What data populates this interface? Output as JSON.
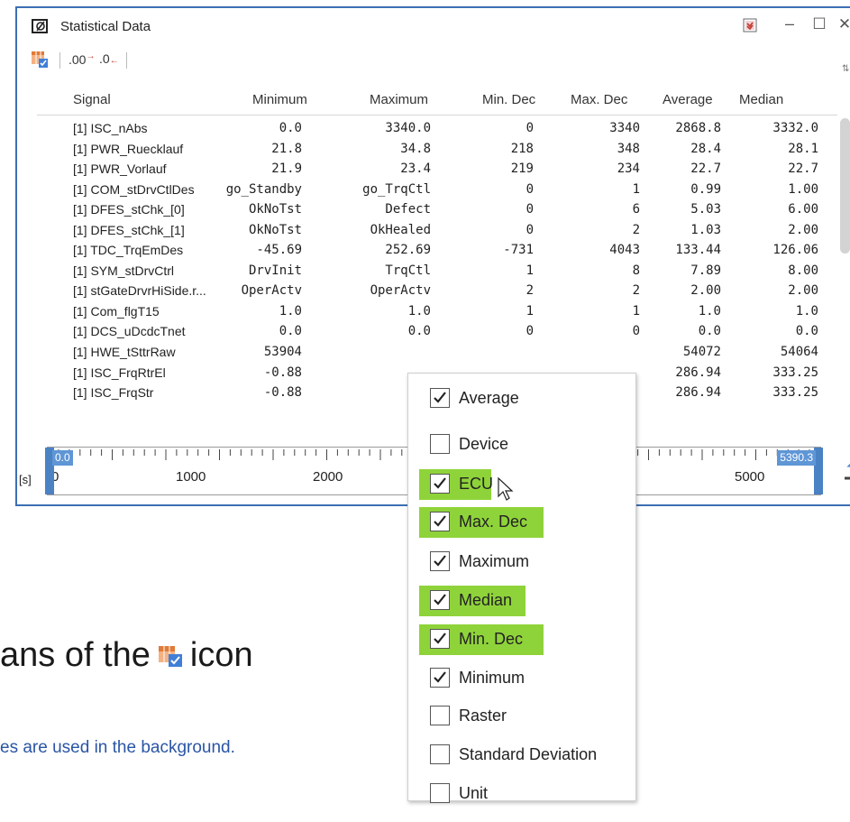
{
  "background": {
    "heading_fragment": "ans of the",
    "heading_suffix": "icon",
    "note_fragment": "es are used in the background."
  },
  "window": {
    "title": "Statistical Data",
    "icon": "diameter-icon",
    "buttons": {
      "minimize": "–",
      "maximize": "☐",
      "close": "✕"
    }
  },
  "toolbar": {
    "column_chooser_icon": "column-chooser-icon",
    "increase_decimals": ".00",
    "decrease_decimals": ".0"
  },
  "columns": [
    "Signal",
    "Minimum",
    "Maximum",
    "Min. Dec",
    "Max. Dec",
    "Average",
    "Median"
  ],
  "rows": [
    {
      "signal": "[1] ISC_nAbs",
      "min": "0.0",
      "max": "3340.0",
      "min_dec": "0",
      "max_dec": "3340",
      "avg": "2868.8",
      "median": "3332.0"
    },
    {
      "signal": "[1] PWR_Ruecklauf",
      "min": "21.8",
      "max": "34.8",
      "min_dec": "218",
      "max_dec": "348",
      "avg": "28.4",
      "median": "28.1"
    },
    {
      "signal": "[1] PWR_Vorlauf",
      "min": "21.9",
      "max": "23.4",
      "min_dec": "219",
      "max_dec": "234",
      "avg": "22.7",
      "median": "22.7"
    },
    {
      "signal": "[1] COM_stDrvCtlDes",
      "min": "go_Standby",
      "max": "go_TrqCtl",
      "min_dec": "0",
      "max_dec": "1",
      "avg": "0.99",
      "median": "1.00"
    },
    {
      "signal": "[1] DFES_stChk_[0]",
      "min": "OkNoTst",
      "max": "Defect",
      "min_dec": "0",
      "max_dec": "6",
      "avg": "5.03",
      "median": "6.00"
    },
    {
      "signal": "[1] DFES_stChk_[1]",
      "min": "OkNoTst",
      "max": "OkHealed",
      "min_dec": "0",
      "max_dec": "2",
      "avg": "1.03",
      "median": "2.00"
    },
    {
      "signal": "[1] TDC_TrqEmDes",
      "min": "-45.69",
      "max": "252.69",
      "min_dec": "-731",
      "max_dec": "4043",
      "avg": "133.44",
      "median": "126.06"
    },
    {
      "signal": "[1] SYM_stDrvCtrl",
      "min": "DrvInit",
      "max": "TrqCtl",
      "min_dec": "1",
      "max_dec": "8",
      "avg": "7.89",
      "median": "8.00"
    },
    {
      "signal": "[1] stGateDrvrHiSide.r...",
      "min": "OperActv",
      "max": "OperActv",
      "min_dec": "2",
      "max_dec": "2",
      "avg": "2.00",
      "median": "2.00"
    },
    {
      "signal": "[1] Com_flgT15",
      "min": "1.0",
      "max": "1.0",
      "min_dec": "1",
      "max_dec": "1",
      "avg": "1.0",
      "median": "1.0"
    },
    {
      "signal": "[1] DCS_uDcdcTnet",
      "min": "0.0",
      "max": "0.0",
      "min_dec": "0",
      "max_dec": "0",
      "avg": "0.0",
      "median": "0.0"
    },
    {
      "signal": "[1] HWE_tSttrRaw",
      "min": "53904",
      "max": "",
      "min_dec": "",
      "max_dec": "",
      "avg": "54072",
      "median": "54064"
    },
    {
      "signal": "[1] ISC_FrqRtrEl",
      "min": "-0.88",
      "max": "",
      "min_dec": "",
      "max_dec": "",
      "avg": "286.94",
      "median": "333.25"
    },
    {
      "signal": "[1] ISC_FrqStr",
      "min": "-0.88",
      "max": "",
      "min_dec": "",
      "max_dec": "",
      "avg": "286.94",
      "median": "333.25"
    }
  ],
  "timeline": {
    "unit": "[s]",
    "start_value": "0.0",
    "end_value": "5390.3",
    "zero_label": "0",
    "tick_labels": [
      "1000",
      "2000",
      "5000"
    ]
  },
  "column_menu": {
    "items": [
      {
        "label": "Average",
        "checked": true,
        "highlighted": false
      },
      {
        "label": "Device",
        "checked": false,
        "highlighted": false
      },
      {
        "label": "ECU",
        "checked": true,
        "highlighted": true
      },
      {
        "label": "Max. Dec",
        "checked": true,
        "highlighted": true
      },
      {
        "label": "Maximum",
        "checked": true,
        "highlighted": false
      },
      {
        "label": "Median",
        "checked": true,
        "highlighted": true
      },
      {
        "label": "Min. Dec",
        "checked": true,
        "highlighted": true
      },
      {
        "label": "Minimum",
        "checked": true,
        "highlighted": false
      },
      {
        "label": "Raster",
        "checked": false,
        "highlighted": false
      },
      {
        "label": "Standard Deviation",
        "checked": false,
        "highlighted": false
      },
      {
        "label": "Unit",
        "checked": false,
        "highlighted": false
      }
    ]
  },
  "colors": {
    "window_border": "#3c6fb4",
    "highlight": "#8fd33a",
    "timeline_handle": "#4a82c4",
    "note_text": "#2a55a6"
  }
}
